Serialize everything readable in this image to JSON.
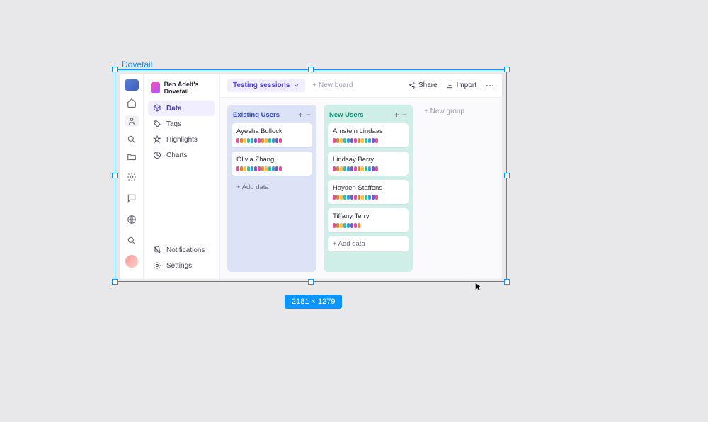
{
  "selection": {
    "label": "Dovetail",
    "dimensions": "2181 × 1279"
  },
  "workspace": {
    "name": "Ben Adelt's Dovetail"
  },
  "sidebar_nav": [
    {
      "label": "Data",
      "name": "data",
      "selected": true
    },
    {
      "label": "Tags",
      "name": "tags",
      "selected": false
    },
    {
      "label": "Highlights",
      "name": "highlights",
      "selected": false
    },
    {
      "label": "Charts",
      "name": "charts",
      "selected": false
    }
  ],
  "sidebar_footer": [
    {
      "label": "Notifications",
      "name": "notifications"
    },
    {
      "label": "Settings",
      "name": "settings"
    }
  ],
  "topbar": {
    "breadcrumb": "Testing sessions",
    "new_board": "+ New board",
    "share": "Share",
    "import": "Import"
  },
  "board": {
    "columns": [
      {
        "title": "Existing Users",
        "key": "existing",
        "cards": [
          {
            "name": "Ayesha Bullock",
            "tags": 13
          },
          {
            "name": "Olivia Zhang",
            "tags": 13
          }
        ],
        "add_label": "+ Add data"
      },
      {
        "title": "New Users",
        "key": "new",
        "cards": [
          {
            "name": "Arnstein Lindaas",
            "tags": 13
          },
          {
            "name": "Lindsay Berry",
            "tags": 13
          },
          {
            "name": "Hayden Staffens",
            "tags": 13
          },
          {
            "name": "Tiffany Terry",
            "tags": 8
          }
        ],
        "add_label": "+ Add data"
      }
    ],
    "new_group": "+ New group"
  },
  "tag_colors": [
    "#e94f8a",
    "#f07b3a",
    "#f5c542",
    "#3cc08f",
    "#3b9de0",
    "#6a5ae0",
    "#e94f8a",
    "#f07b3a",
    "#f5c542",
    "#3cc08f",
    "#3b9de0",
    "#6a5ae0",
    "#e94f8a"
  ]
}
